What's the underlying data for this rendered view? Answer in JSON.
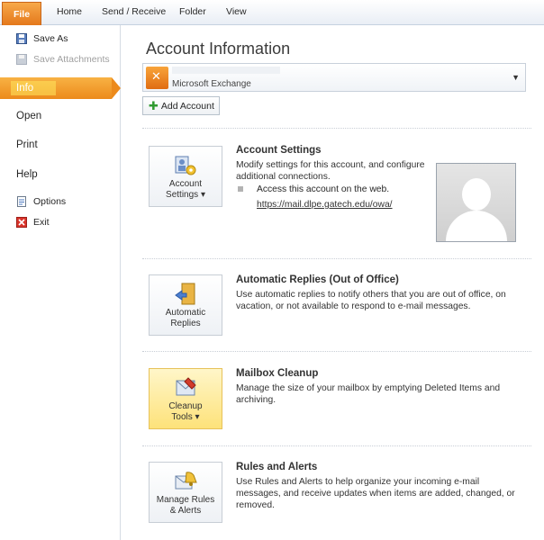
{
  "ribbon": {
    "tabs": [
      "File",
      "Home",
      "Send / Receive",
      "Folder",
      "View"
    ]
  },
  "backstage": {
    "save_as": "Save As",
    "save_attachments": "Save Attachments",
    "info": "Info",
    "open": "Open",
    "print": "Print",
    "help": "Help",
    "options": "Options",
    "exit": "Exit"
  },
  "main": {
    "title": "Account Information",
    "account_type": "Microsoft Exchange",
    "add_account": "Add Account",
    "sections": [
      {
        "button_line1": "Account",
        "button_line2": "Settings ▾",
        "title": "Account Settings",
        "desc": "Modify settings for this account, and configure additional connections.",
        "bullet": "Access this account on the web.",
        "link": "https://mail.dlpe.gatech.edu/owa/"
      },
      {
        "button_line1": "Automatic",
        "button_line2": "Replies",
        "title": "Automatic Replies (Out of Office)",
        "desc": "Use automatic replies to notify others that you are out of office, on vacation, or not available to respond to e-mail messages."
      },
      {
        "button_line1": "Cleanup",
        "button_line2": "Tools ▾",
        "title": "Mailbox Cleanup",
        "desc": "Manage the size of your mailbox by emptying Deleted Items and archiving."
      },
      {
        "button_line1": "Manage Rules",
        "button_line2": "& Alerts",
        "title": "Rules and Alerts",
        "desc": "Use Rules and Alerts to help organize your incoming e-mail messages, and receive updates when items are added, changed, or removed."
      }
    ]
  },
  "colors": {
    "file_tab": "#e4781b",
    "selected": "#ec8a1b",
    "hot_button": "#fde27a"
  }
}
